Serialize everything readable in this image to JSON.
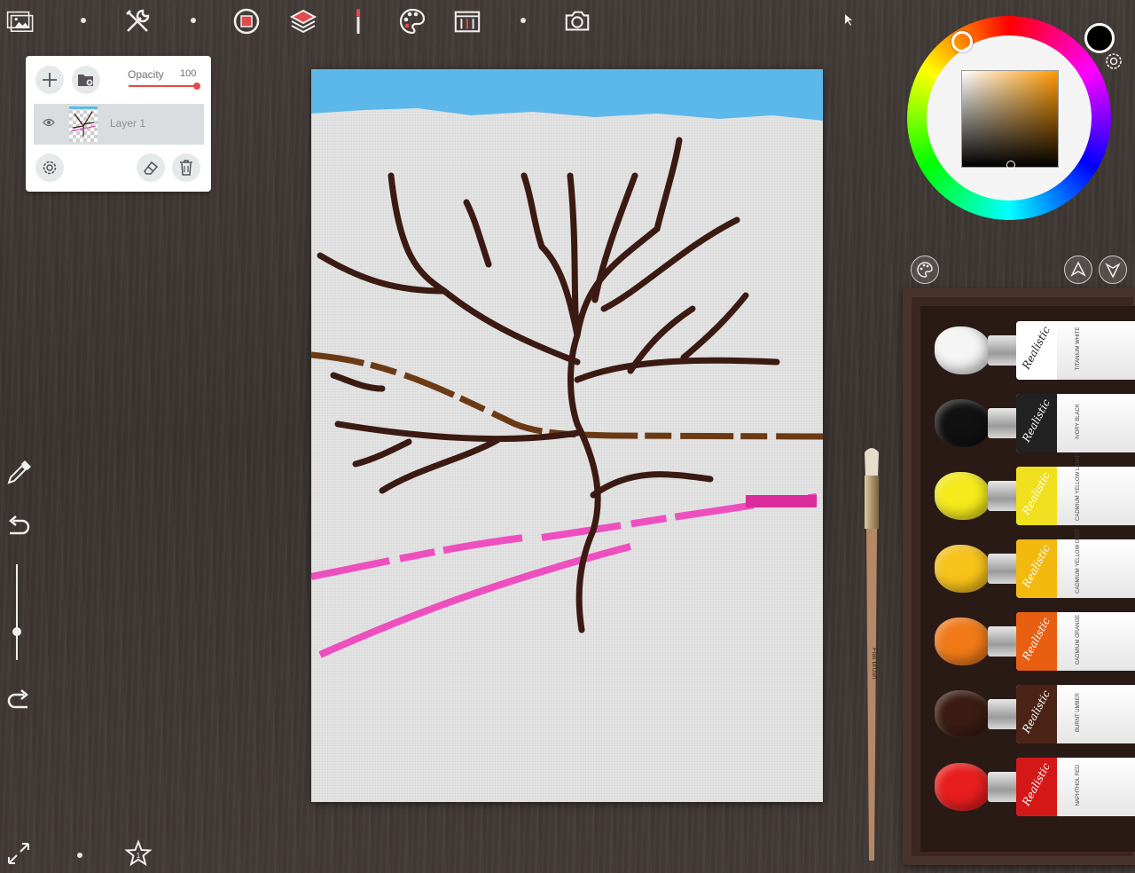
{
  "toolbar": {
    "items": [
      {
        "name": "gallery-icon",
        "label": "Gallery"
      },
      {
        "name": "tools-icon",
        "label": "Tools"
      },
      {
        "name": "record-icon",
        "label": "Record"
      },
      {
        "name": "layers-icon",
        "label": "Layers"
      },
      {
        "name": "brush-tool-icon",
        "label": "Brush"
      },
      {
        "name": "palette-icon",
        "label": "Palette"
      },
      {
        "name": "canvas-settings-icon",
        "label": "Canvas"
      },
      {
        "name": "camera-icon",
        "label": "Camera"
      }
    ]
  },
  "layers_panel": {
    "opacity_label": "Opacity",
    "opacity_value": "100",
    "opacity_fraction": 1.0,
    "layers": [
      {
        "name": "Layer 1",
        "visible": true,
        "selected": true
      }
    ]
  },
  "color_picker": {
    "current_color": "#000000",
    "hue_color": "#ff9900"
  },
  "paint_box": {
    "brand": "Realistic",
    "tubes": [
      {
        "color": "#f5f5f5",
        "band": "#ffffff",
        "name": "TITANIUM WHITE"
      },
      {
        "color": "#111111",
        "band": "#222222",
        "name": "IVORY BLACK"
      },
      {
        "color": "#f4ea1c",
        "band": "#f0e020",
        "name": "CADMIUM YELLOW LIGHT"
      },
      {
        "color": "#f7c21a",
        "band": "#f3b90f",
        "name": "CADMIUM YELLOW DEEP"
      },
      {
        "color": "#f07a18",
        "band": "#e85f12",
        "name": "CADMIUM ORANGE"
      },
      {
        "color": "#3a1c12",
        "band": "#4b2417",
        "name": "BURNT UMBER"
      },
      {
        "color": "#e81e1e",
        "band": "#d41818",
        "name": "NAPHTHOL RED"
      }
    ]
  },
  "brush": {
    "label": "Flat brush"
  },
  "colors": {
    "accent": "#e24b4b",
    "wood": "#3e3734",
    "canvas": "#e3e3e3"
  }
}
